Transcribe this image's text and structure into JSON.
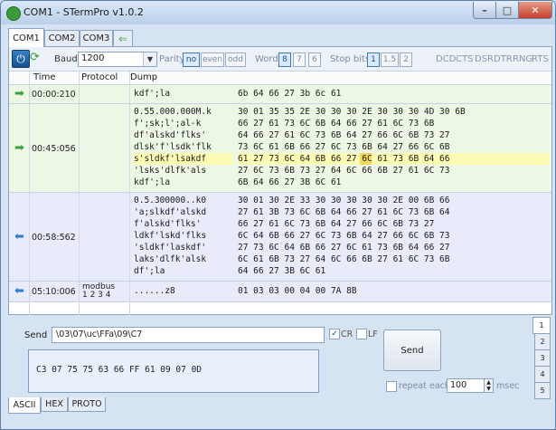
{
  "window": {
    "title": "COM1 - STermPro v1.0.2",
    "min": "–",
    "max": "□",
    "close": "✕"
  },
  "tabs": [
    "COM1",
    "COM2",
    "COM3"
  ],
  "toolbar": {
    "baud_label": "Baud",
    "baud_value": "1200",
    "parity_label": "Parity",
    "parity_options": [
      "no",
      "even",
      "odd"
    ],
    "word_label": "Word",
    "word_options": [
      "8",
      "7",
      "6"
    ],
    "stop_label": "Stop bits",
    "stop_options": [
      "1",
      "1.5",
      "2"
    ],
    "signals": [
      "DCD",
      "CTS",
      "DSR",
      "DTR",
      "RNG",
      "RTS"
    ]
  },
  "grid": {
    "columns": [
      "Time",
      "Protocol",
      "Dump"
    ],
    "rows": [
      {
        "dir": "in",
        "time": "00:00:210",
        "protocol": "",
        "ascii": [
          "kdf';la"
        ],
        "hex": [
          "6b 64 66 27 3b 6c 61"
        ]
      },
      {
        "dir": "in",
        "time": "00:45:056",
        "protocol": "",
        "ascii": [
          "0.55.000.000M.k",
          "f';sk;l';al-k",
          "df'alskd'flks'",
          "dlsk'f'lsdk'flk",
          "s'sldkf'lsakdf",
          "'lsks'dlfk'als",
          "kdf';la"
        ],
        "hex": [
          "30 01 35 35 2E 30 30 30 2E 30 30 30 4D 30 6B",
          "66 27 61 73 6C 6B 64 66 27 61 6C 73 6B",
          "64 66 27 61 6C 73 6B 64 27 66 6C 6B 73 27",
          "73 6C 61 6B 66 27 6C 73 6B 64 27 66 6C 6B",
          "61 27 73 6C 64 6B 66 27 6C 61 73 6B 64 66",
          "27 6C 73 6B 73 27 64 6C 66 6B 27 61 6C 73",
          "6B 64 66 27 3B 6C 61"
        ]
      },
      {
        "dir": "out",
        "time": "00:58:562",
        "protocol": "",
        "ascii": [
          "0.5.300000..k0",
          "'a;slkdf'alskd",
          "f'alskd'flks'",
          "ldkf'lskd'flks",
          "'sldkf'laskdf'",
          "laks'dlfk'alsk",
          "df';la"
        ],
        "hex": [
          "30 01 30 2E 33 30 30 30 30 30 2E 00 6B 66",
          "27 61 3B 73 6C 6B 64 66 27 61 6C 73 6B 64",
          "66 27 61 6C 73 6B 64 27 66 6C 6B 73 27",
          "6C 64 6B 66 27 6C 73 6B 64 27 66 6C 6B 73",
          "27 73 6C 64 6B 66 27 6C 61 73 6B 64 66 27",
          "6C 61 6B 73 27 64 6C 66 6B 27 61 6C 73 6B",
          "64 66 27 3B 6C 61"
        ]
      },
      {
        "dir": "out",
        "time": "05:10:006",
        "protocol": "modbus 1 2 3 4",
        "ascii": [
          "......z8"
        ],
        "hex": [
          "01 03 03 00 04 00 7A 8B"
        ]
      }
    ]
  },
  "send": {
    "label": "Send",
    "value": "\\03\\07\\uc\\FFa\\09\\C7",
    "cr_label": "CR",
    "lf_label": "LF",
    "hex_preview": "C3 07 75 75 63 66 FF 61 09 07 0D",
    "button": "Send",
    "repeat_label": "repeat each",
    "repeat_value": "100",
    "msec_label": "msec"
  },
  "side_tabs": [
    "1",
    "2",
    "3",
    "4",
    "5"
  ],
  "bottom_tabs": [
    "ASCII",
    "HEX",
    "PROTO"
  ],
  "colors": {
    "accent": "#3a78c2",
    "in_row": "#ecf7e6",
    "out_row": "#e8ecfa",
    "highlight": "#fdfcb4"
  }
}
